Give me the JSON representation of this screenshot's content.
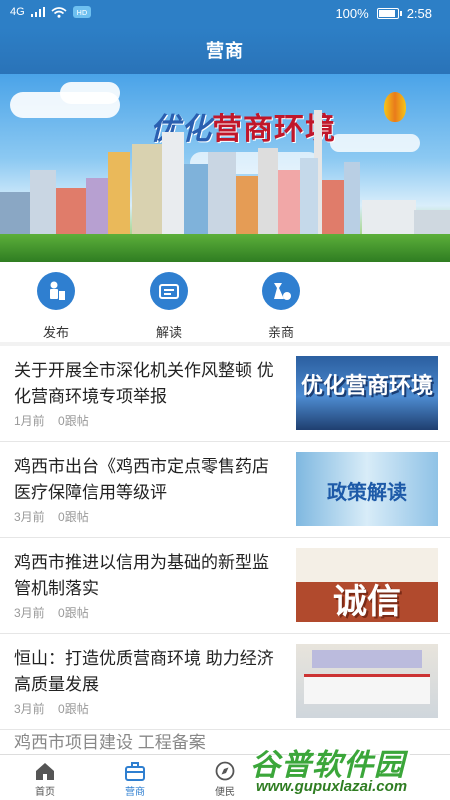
{
  "status_bar": {
    "network": "4G",
    "battery_percent": "100%",
    "battery_level": 1.0,
    "time": "2:58"
  },
  "header": {
    "title": "营商"
  },
  "banner": {
    "title_prefix": "优化",
    "title_main": "营商环境"
  },
  "quick_actions": [
    {
      "label": "发布",
      "icon": "publish-icon"
    },
    {
      "label": "解读",
      "icon": "interpret-icon"
    },
    {
      "label": "亲商",
      "icon": "pro-business-icon"
    }
  ],
  "news": [
    {
      "title": "关于开展全市深化机关作风整顿 优化营商环境专项举报",
      "time": "1月前",
      "replies": "0跟帖",
      "thumb_text": "优化营商环境"
    },
    {
      "title": "鸡西市出台《鸡西市定点零售药店医疗保障信用等级评",
      "time": "3月前",
      "replies": "0跟帖",
      "thumb_text": "政策解读"
    },
    {
      "title": "鸡西市推进以信用为基础的新型监管机制落实",
      "time": "3月前",
      "replies": "0跟帖",
      "thumb_text": "诚信"
    },
    {
      "title": "恒山：打造优质营商环境 助力经济高质量发展",
      "time": "3月前",
      "replies": "0跟帖",
      "thumb_text": ""
    },
    {
      "title": "鸡西市项目建设 工程备案",
      "time": "",
      "replies": "",
      "thumb_text": ""
    }
  ],
  "bottom_nav": [
    {
      "label": "首页",
      "icon": "home-icon",
      "active": false
    },
    {
      "label": "营商",
      "icon": "briefcase-icon",
      "active": true
    },
    {
      "label": "便民",
      "icon": "compass-icon",
      "active": false
    }
  ],
  "watermark": {
    "name": "谷普软件园",
    "url": "www.gupuxlazai.com"
  },
  "colors": {
    "primary": "#2f7fd0",
    "header": "#2d7fc6"
  }
}
